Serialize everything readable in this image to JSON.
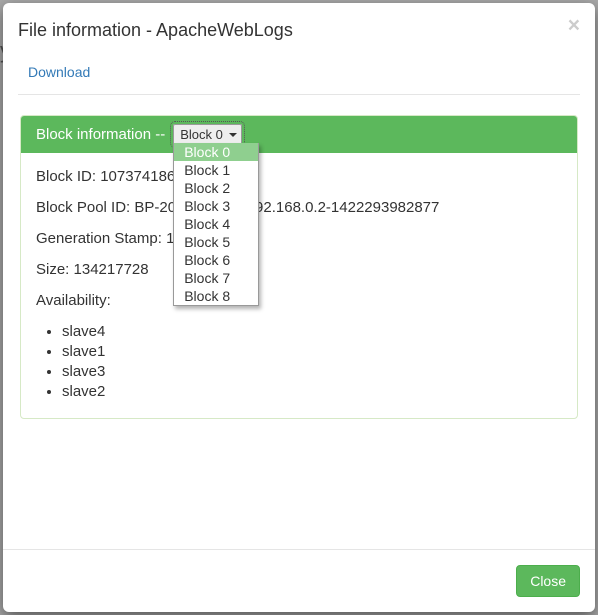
{
  "backdrop_hint": "y",
  "modal": {
    "title": "File information - ApacheWebLogs",
    "download_label": "Download",
    "close_button_label": "Close"
  },
  "block_panel": {
    "heading_prefix": "Block information -- ",
    "select_value": "Block 0",
    "options": [
      "Block 0",
      "Block 1",
      "Block 2",
      "Block 3",
      "Block 4",
      "Block 5",
      "Block 6",
      "Block 7",
      "Block 8"
    ]
  },
  "block_details": {
    "block_id_label": "Block ID: ",
    "block_id_value": "1073741864",
    "block_pool_id_label": "Block Pool ID: ",
    "block_pool_id_value": "BP-2048114545-192.168.0.2-1422293982877",
    "gen_stamp_label": "Generation Stamp: ",
    "gen_stamp_value": "1040",
    "size_label": "Size: ",
    "size_value": "134217728",
    "availability_label": "Availability:",
    "availability": [
      "slave4",
      "slave1",
      "slave3",
      "slave2"
    ]
  }
}
